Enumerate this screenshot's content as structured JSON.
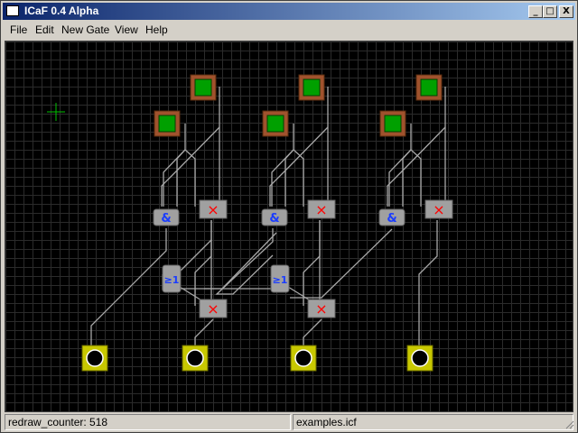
{
  "window": {
    "title": "ICaF 0.4 Alpha"
  },
  "titlebar_buttons": {
    "minimize": "_",
    "maximize": "□",
    "close": "X"
  },
  "menu": [
    "File",
    "Edit",
    "New Gate",
    "View",
    "Help"
  ],
  "status": {
    "left": "redraw_counter: 518",
    "right": "examples.icf"
  },
  "gates": {
    "and_symbol": "&",
    "or_symbol": "≥1",
    "xor_symbol": "×"
  },
  "colors": {
    "wire": "#a8a8a8",
    "input_green": "#00a000",
    "input_frame": "#a0522d",
    "output_frame": "#c8c800",
    "gate_body": "#a0a0a0",
    "and_gate_text": "#1a3cff",
    "xor_mark": "#ff0000",
    "cursor": "#00c000"
  }
}
